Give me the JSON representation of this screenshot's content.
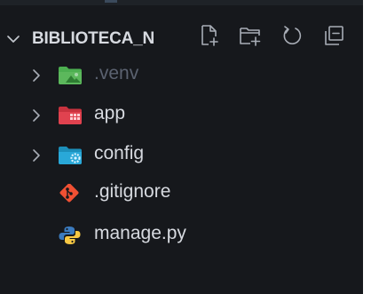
{
  "explorer": {
    "folder_title": "BIBLIOTECA_N",
    "header_icons": [
      "new-file-icon",
      "new-folder-icon",
      "refresh-icon",
      "collapse-all-icon"
    ],
    "items": [
      {
        "label": "venv",
        "display": ".venv",
        "type": "folder",
        "expandable": true,
        "icon": "venv-folder-icon",
        "icon_color": "#5cb85c",
        "dimmed": true
      },
      {
        "label": "app",
        "display": "app",
        "type": "folder",
        "expandable": true,
        "icon": "app-folder-icon",
        "icon_color": "#e0424f",
        "dimmed": false
      },
      {
        "label": "config",
        "display": "config",
        "type": "folder",
        "expandable": true,
        "icon": "config-folder-icon",
        "icon_color": "#29a8d8",
        "dimmed": false
      },
      {
        "label": "gitignore",
        "display": ".gitignore",
        "type": "file",
        "expandable": false,
        "icon": "git-icon",
        "icon_color": "#f05033",
        "dimmed": false
      },
      {
        "label": "manage",
        "display": "manage.py",
        "type": "file",
        "expandable": false,
        "icon": "python-icon",
        "icon_color": "#f7c843",
        "dimmed": false
      }
    ]
  },
  "colors": {
    "background": "#16181c",
    "text": "#d7dae0",
    "text_dimmed": "#5b6270",
    "icon_gray": "#a8adb6"
  }
}
